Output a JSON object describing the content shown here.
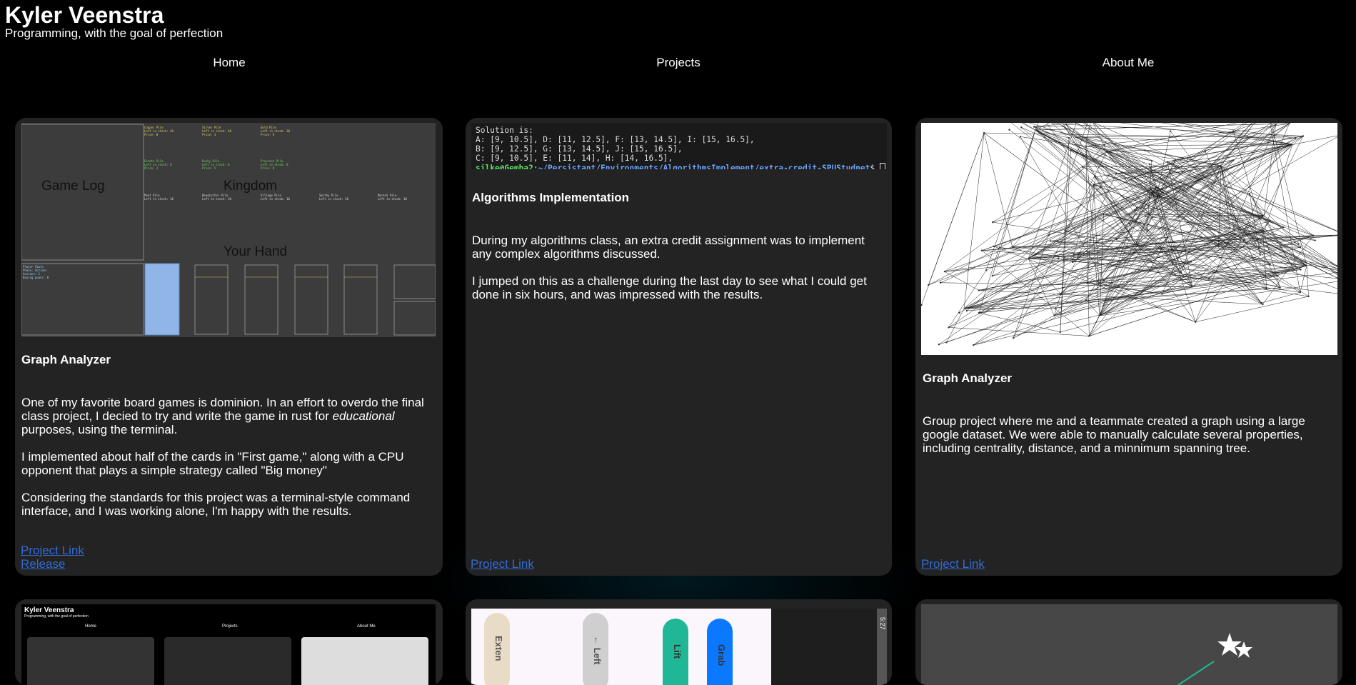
{
  "header": {
    "title": "Kyler Veenstra",
    "tagline": "Programming, with the goal of perfection"
  },
  "nav": [
    {
      "label": "Home"
    },
    {
      "label": "Projects"
    },
    {
      "label": "About Me"
    }
  ],
  "cards": [
    {
      "screenshot": {
        "game_log": "Game Log",
        "kingdom": "Kingdom",
        "your_hand": "Your Hand"
      },
      "title": "Graph Analyzer",
      "paragraphs": [
        "One of my favorite board games is dominion. In an effort to overdo the final class project, I decied to try and write the game in rust for ",
        "educational",
        " purposes, using the terminal.",
        "I implemented about half of the cards in \"First game,\" along with a CPU opponent that plays a simple strategy called \"Big money\"",
        "Considering the standards for this project was a terminal-style command interface, and I was working alone, I'm happy with the results."
      ],
      "links": [
        "Project Link",
        "Release"
      ]
    },
    {
      "terminal": {
        "line1": "Solution is:",
        "line2": "A: [9, 10.5], D: [11, 12.5], F: [13, 14.5], I: [15, 16.5],",
        "line3": "B: [9, 12.5], G: [13, 14.5], J: [15, 16.5],",
        "line4": "C: [9, 10.5], E: [11, 14], H: [14, 16.5],",
        "prompt_user": "silke@Gemba2",
        "prompt_path": ":~/Persistant/Environments/AlgorithmsImplement/extra-credit-SPUStudnet",
        "prompt_end": "$ "
      },
      "title": "Algorithms Implementation",
      "paragraphs": [
        "During my algorithms class, an extra credit assignment was to implement any complex algorithms discussed.",
        "I jumped on this as a challenge during the last day to see what I could get done in six hours, and was impressed with the results."
      ],
      "links": [
        "Project Link"
      ]
    },
    {
      "title": "Graph Analyzer",
      "paragraphs": [
        "Group project where me and a teammate created a graph using a large google dataset. We were able to manually calculate several properties, including centrality, distance, and a minnimum spanning tree."
      ],
      "links": [
        "Project Link"
      ]
    }
  ],
  "bottom_row": {
    "mini_site": {
      "title": "Kyler Veenstra",
      "tagline": "Programming, with the goal of perfection",
      "nav": [
        "Home",
        "Projects",
        "About Me"
      ]
    },
    "phone_buttons": [
      "Exten",
      "← Left",
      "Lift",
      "Grab"
    ],
    "phone_status": "5:27"
  },
  "colors": {
    "background": "#000000",
    "card": "#232323",
    "link": "#2f6bd6",
    "terminal_user": "#5fe36a",
    "terminal_path": "#6aa6ff"
  }
}
